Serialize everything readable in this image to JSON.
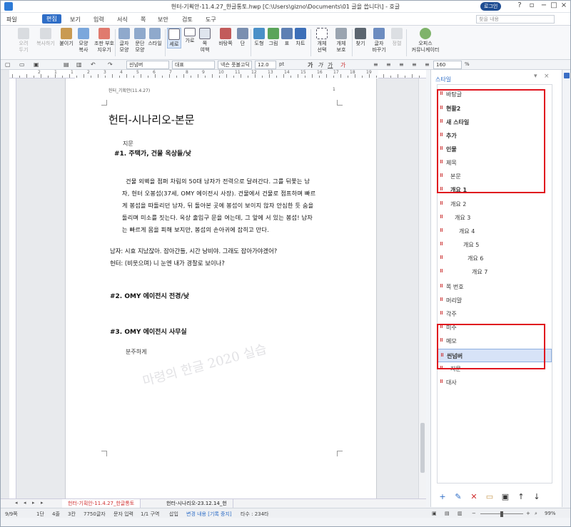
{
  "window": {
    "title": "헌터-기획안-11.4.27_한글통토.hwp [C:\\Users\\gizno\\Documents\\01 글을 씁니다\\] - 호글",
    "login_label": "로그인",
    "controls": [
      "?",
      "▫",
      "−",
      "□",
      "×"
    ]
  },
  "menubar": {
    "items": [
      "파일",
      "편집",
      "보기",
      "입력",
      "서식",
      "쪽",
      "보안",
      "검토",
      "도구"
    ],
    "active": "편집",
    "help_placeholder": "찾을 내용"
  },
  "ribbon": {
    "buttons": [
      {
        "label": "오려\n두기",
        "icon": "scissors-icon",
        "disabled": true
      },
      {
        "label": "복사하기",
        "icon": "copy-icon",
        "disabled": true
      },
      {
        "label": "붙이기",
        "icon": "paste-icon",
        "disabled": false
      },
      {
        "label": "모양\n복사",
        "icon": "format-painter-icon",
        "disabled": false
      },
      {
        "label": "조판 부호\n지우기",
        "icon": "clear-codes-icon",
        "disabled": false
      },
      {
        "label": "글자\n모양",
        "icon": "char-shape-icon",
        "disabled": false
      },
      {
        "label": "문단\n모양",
        "icon": "para-shape-icon",
        "disabled": false
      },
      {
        "label": "스타일",
        "icon": "style-icon",
        "disabled": false
      },
      {
        "label": "세로",
        "icon": "portrait-icon",
        "disabled": false,
        "selected": true
      },
      {
        "label": "가로",
        "icon": "landscape-icon",
        "disabled": false
      },
      {
        "label": "쪽\n여백",
        "icon": "margin-icon",
        "disabled": false
      },
      {
        "label": "바탕쪽",
        "icon": "master-page-icon",
        "disabled": false
      },
      {
        "label": "단",
        "icon": "columns-icon",
        "disabled": false
      },
      {
        "label": "도형",
        "icon": "shape-icon",
        "disabled": false
      },
      {
        "label": "그림",
        "icon": "picture-icon",
        "disabled": false
      },
      {
        "label": "표",
        "icon": "table-icon",
        "disabled": false
      },
      {
        "label": "차트",
        "icon": "chart-icon",
        "disabled": false
      },
      {
        "label": "개체\n선택",
        "icon": "select-object-icon",
        "disabled": false
      },
      {
        "label": "개체\n보호",
        "icon": "protect-object-icon",
        "disabled": false
      },
      {
        "label": "찾기",
        "icon": "binoculars-icon",
        "disabled": false
      },
      {
        "label": "글자\n바꾸기",
        "icon": "replace-icon",
        "disabled": false
      },
      {
        "label": "정렬",
        "icon": "sort-icon",
        "disabled": true
      },
      {
        "label": "오피스\n커뮤니케이터",
        "icon": "communicator-icon",
        "disabled": false
      }
    ]
  },
  "format_toolbar": {
    "style": "씬넘버",
    "font_lang": "대표",
    "font": "넥슨 풋볼고딕 E",
    "size": "12.0",
    "size_unit": "pt",
    "zoom": "160",
    "zoom_unit": "%"
  },
  "ruler_numbers": [
    "2",
    "1",
    "1",
    "2",
    "3",
    "4",
    "5",
    "6",
    "7",
    "8",
    "9",
    "10",
    "11",
    "12",
    "13",
    "14",
    "15",
    "16",
    "17",
    "18",
    "19"
  ],
  "document": {
    "header_small": "헌터_기획안(11.4.27)",
    "page_marker": "1",
    "title": "헌터-시나리오-본문",
    "direction1": "지문",
    "scene1": "#1. 주택가, 건물 옥상들/낮",
    "para_lines": [
      "건물 외벽을 점퍼 차림의 50대 남자가 전력으로 달려간다. 그를 뒤쫓는 남",
      "자, 헌터 오봉섭(37세, OMY 에이전시 사장). 건물에서 건물로 점프하며 빠르",
      "게 봉섭을 따돌리던 남자, 뒤 돌아본 곳에 봉섭이 보이지 않자 안심한 듯 숨을",
      "돌리며 미소를 짓는다. 옥상 출입구 문을 여는데, 그 앞에 서 있는 봉섭! 남자",
      "는 빠르게 몸을 피해 보지만, 봉섭의 손아귀에 잡히고 만다."
    ],
    "dialogue": [
      "남자: 시효 지났잖아. 잡아간들, 시간 낭비야. 그래도 잡아가야겠어?",
      "헌터: (비웃으며) 니 눈엔 내가 경찰로 보이나?"
    ],
    "scene2": "#2. OMY 에이전시 전경/낮",
    "scene3": "#3. OMY 에이전시 사무실",
    "direction2": "분주하게",
    "watermark": "마령의 한글 2020 실습"
  },
  "doc_tabs": [
    "헌터-기획안-11.4.27_한글통토",
    "헌터-시나리오-23.12.14_헌"
  ],
  "statusbar": {
    "page": "9/9쪽",
    "col": "1단",
    "line": "4줄",
    "chars": "3칸",
    "count": "7750글자",
    "input": "문자 입력",
    "section": "1/1 구역",
    "insert": "삽입",
    "track": "변경 내용 [기록 중지]",
    "typing": "타수 : 234타",
    "zoom": "99%"
  },
  "style_panel": {
    "title": "스타일",
    "items": [
      {
        "label": "바탕글",
        "indent": 0,
        "bold": false
      },
      {
        "label": "현활2",
        "indent": 0,
        "bold": true
      },
      {
        "label": "새 스타일",
        "indent": 0,
        "bold": true
      },
      {
        "label": "추가",
        "indent": 0,
        "bold": true
      },
      {
        "label": "인물",
        "indent": 0,
        "bold": true
      },
      {
        "label": "제목",
        "indent": 0,
        "bold": false
      },
      {
        "label": "본문",
        "indent": 1,
        "bold": false
      },
      {
        "label": "개요 1",
        "indent": 1,
        "bold": true
      },
      {
        "label": "개요 2",
        "indent": 1,
        "bold": false
      },
      {
        "label": "개요 3",
        "indent": 2,
        "bold": false
      },
      {
        "label": "개요 4",
        "indent": 3,
        "bold": false
      },
      {
        "label": "개요 5",
        "indent": 4,
        "bold": false
      },
      {
        "label": "개요 6",
        "indent": 5,
        "bold": false
      },
      {
        "label": "개요 7",
        "indent": 6,
        "bold": false
      },
      {
        "label": "쪽 번호",
        "indent": 0,
        "bold": false
      },
      {
        "label": "머리말",
        "indent": 0,
        "bold": false
      },
      {
        "label": "각주",
        "indent": 0,
        "bold": false
      },
      {
        "label": "미주",
        "indent": 0,
        "bold": false
      },
      {
        "label": "메모",
        "indent": 0,
        "bold": false
      },
      {
        "label": "씬넘버",
        "indent": 0,
        "bold": true,
        "selected": true
      },
      {
        "label": "지문",
        "indent": 1,
        "bold": false
      },
      {
        "label": "대사",
        "indent": 0,
        "bold": false
      }
    ],
    "buttons": [
      {
        "icon": "add-icon",
        "glyph": "+"
      },
      {
        "icon": "edit-icon",
        "glyph": "✎"
      },
      {
        "icon": "delete-icon",
        "glyph": "✕"
      },
      {
        "icon": "folder-icon",
        "glyph": "▭"
      },
      {
        "icon": "save-icon",
        "glyph": "▣"
      },
      {
        "icon": "arrow-up-icon",
        "glyph": "↑"
      },
      {
        "icon": "arrow-down-icon",
        "glyph": "↓"
      }
    ]
  },
  "colors": {
    "accent": "#2f6ec7",
    "highlight_box": "#e0141e",
    "active_tab_text": "#d03030"
  }
}
